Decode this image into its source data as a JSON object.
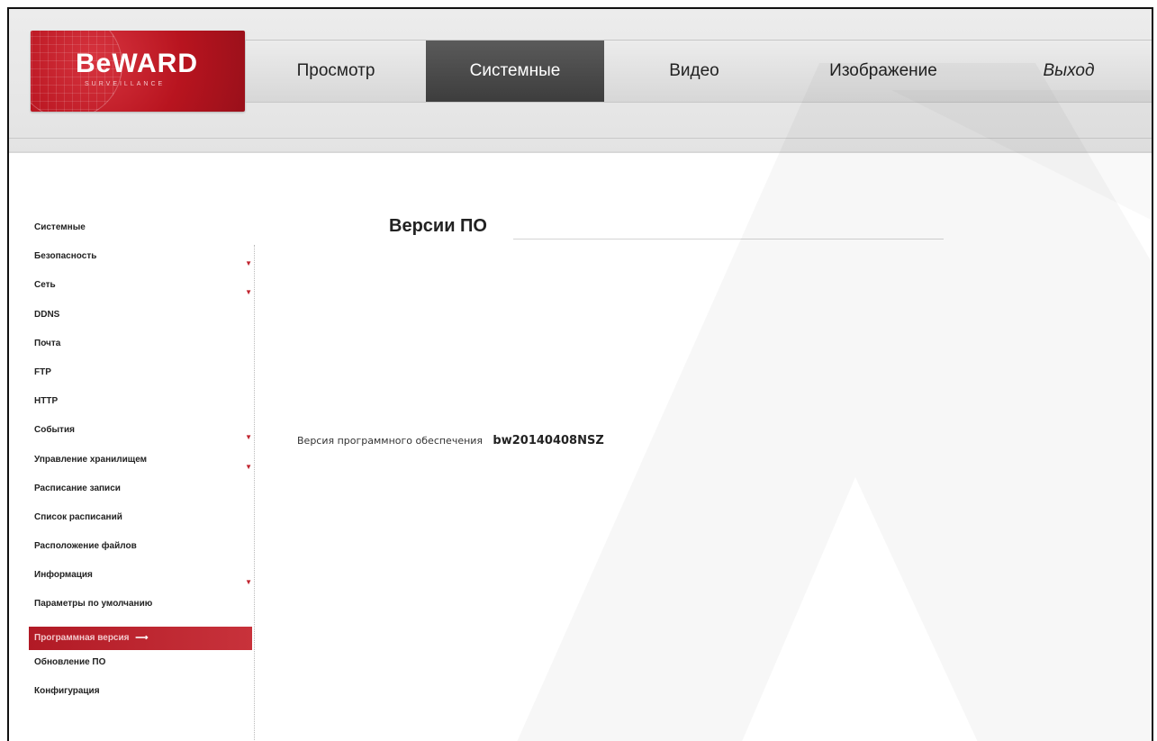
{
  "brand": {
    "logo_text": "BeWARD",
    "logo_subtext": "SURVEILLANCE",
    "logo_color": "#b8141f"
  },
  "nav": {
    "tabs": [
      {
        "label": "Просмотр",
        "active": false
      },
      {
        "label": "Системные",
        "active": true
      },
      {
        "label": "Видео",
        "active": false
      },
      {
        "label": "Изображение",
        "active": false
      },
      {
        "label": "Выход",
        "active": false
      }
    ]
  },
  "sidebar": {
    "items": [
      {
        "label": "Системные",
        "expandable": false
      },
      {
        "label": "Безопасность",
        "expandable": true
      },
      {
        "label": "Сеть",
        "expandable": true
      },
      {
        "label": "DDNS",
        "expandable": false
      },
      {
        "label": "Почта",
        "expandable": false
      },
      {
        "label": "FTP",
        "expandable": false
      },
      {
        "label": "HTTP",
        "expandable": false
      },
      {
        "label": "События",
        "expandable": true
      },
      {
        "label": "Управление хранилищем",
        "expandable": true
      },
      {
        "label": "Расписание записи",
        "expandable": false
      },
      {
        "label": "Список расписаний",
        "expandable": false
      },
      {
        "label": "Расположение файлов",
        "expandable": false
      },
      {
        "label": "Информация",
        "expandable": true
      },
      {
        "label": "Параметры по умолчанию",
        "expandable": false
      },
      {
        "label": "Программная версия",
        "expandable": false,
        "active": true
      },
      {
        "label": "Обновление ПО",
        "expandable": false
      },
      {
        "label": "Конфигурация",
        "expandable": false
      }
    ],
    "active_color": "#b11a25"
  },
  "main": {
    "title": "Версии ПО",
    "firmware_label": "Версия программного обеспечения",
    "firmware_value": "bw20140408NSZ"
  }
}
